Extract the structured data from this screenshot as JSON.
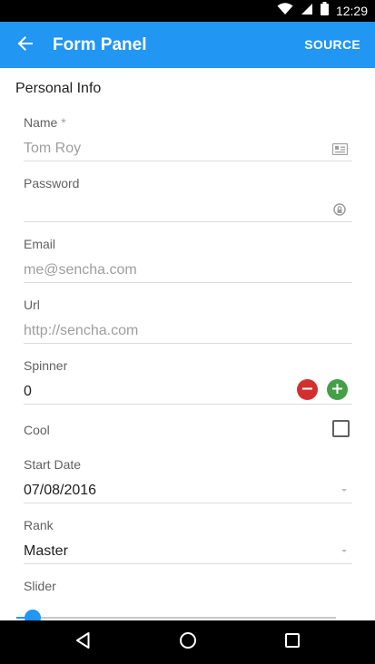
{
  "status_bar": {
    "time": "12:29",
    "icons": [
      "wifi-icon",
      "signal-icon",
      "battery-icon"
    ]
  },
  "app_bar": {
    "title": "Form Panel",
    "back_icon": "arrow-back-icon",
    "source_label": "SOURCE",
    "color": "#2196f3"
  },
  "form": {
    "section_title": "Personal Info",
    "name": {
      "label": "Name",
      "required_mark": "*",
      "placeholder": "Tom Roy",
      "icon": "contact-card-icon"
    },
    "password": {
      "label": "Password",
      "value": "",
      "icon": "reveal-password-icon"
    },
    "email": {
      "label": "Email",
      "placeholder": "me@sencha.com"
    },
    "url": {
      "label": "Url",
      "placeholder": "http://sencha.com"
    },
    "spinner": {
      "label": "Spinner",
      "value": "0",
      "minus_color": "#d32f2f",
      "plus_color": "#43a047"
    },
    "cool": {
      "label": "Cool",
      "checked": false
    },
    "start_date": {
      "label": "Start Date",
      "value": "07/08/2016"
    },
    "rank": {
      "label": "Rank",
      "value": "Master"
    },
    "slider": {
      "label": "Slider",
      "value": 0.05
    }
  },
  "nav_bar": {
    "buttons": [
      "back-triangle-icon",
      "home-circle-icon",
      "recents-square-icon"
    ]
  }
}
